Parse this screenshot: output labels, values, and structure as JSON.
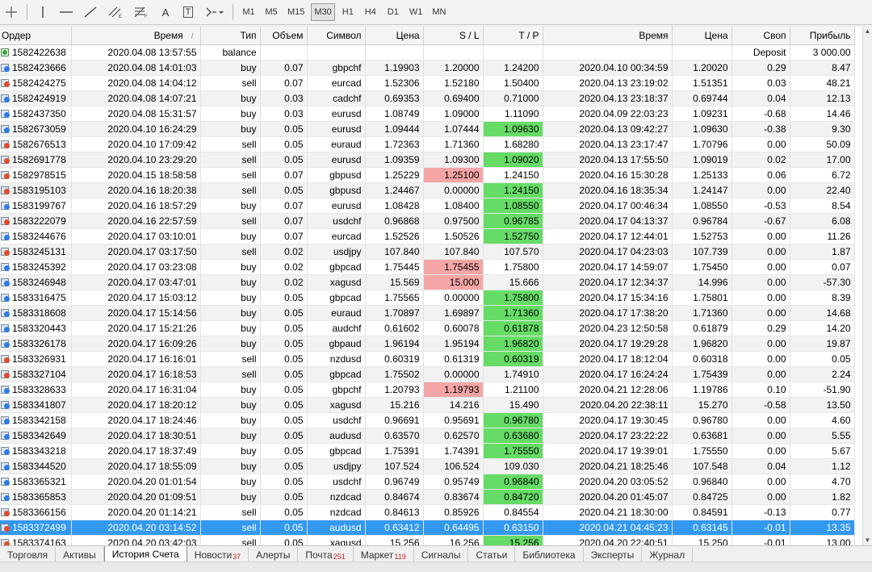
{
  "toolbar": {
    "timeframes": [
      "M1",
      "M5",
      "M15",
      "M30",
      "H1",
      "H4",
      "D1",
      "W1",
      "MN"
    ],
    "active_timeframe": "M30",
    "text_tool": "A",
    "label_tool": "T"
  },
  "columns": [
    "Ордер",
    "Время",
    "Тип",
    "Объем",
    "Символ",
    "Цена",
    "S / L",
    "T / P",
    "Время",
    "Цена",
    "Своп",
    "Прибыль"
  ],
  "rows": [
    {
      "order": "1582422638",
      "open_time": "2020.04.08 13:57:55",
      "type": "balance",
      "volume": "",
      "symbol": "",
      "open_price": "",
      "sl": "",
      "tp": "",
      "close_time": "",
      "close_price": "",
      "swap": "Deposit",
      "profit": "3 000.00"
    },
    {
      "order": "1582423666",
      "open_time": "2020.04.08 14:01:03",
      "type": "buy",
      "volume": "0.07",
      "symbol": "gbpchf",
      "open_price": "1.19903",
      "sl": "1.20000",
      "tp": "1.24200",
      "close_time": "2020.04.10 00:34:59",
      "close_price": "1.20020",
      "swap": "0.29",
      "profit": "8.47"
    },
    {
      "order": "1582424275",
      "open_time": "2020.04.08 14:04:12",
      "type": "sell",
      "volume": "0.07",
      "symbol": "eurcad",
      "open_price": "1.52306",
      "sl": "1.52180",
      "tp": "1.50400",
      "close_time": "2020.04.13 23:19:02",
      "close_price": "1.51351",
      "swap": "0.03",
      "profit": "48.21"
    },
    {
      "order": "1582424919",
      "open_time": "2020.04.08 14:07:21",
      "type": "buy",
      "volume": "0.03",
      "symbol": "cadchf",
      "open_price": "0.69353",
      "sl": "0.69400",
      "tp": "0.71000",
      "close_time": "2020.04.13 23:18:37",
      "close_price": "0.69744",
      "swap": "0.04",
      "profit": "12.13"
    },
    {
      "order": "1582437350",
      "open_time": "2020.04.08 15:31:57",
      "type": "buy",
      "volume": "0.03",
      "symbol": "eurusd",
      "open_price": "1.08749",
      "sl": "1.09000",
      "tp": "1.11090",
      "close_time": "2020.04.09 22:03:23",
      "close_price": "1.09231",
      "swap": "-0.68",
      "profit": "14.46"
    },
    {
      "order": "1582673059",
      "open_time": "2020.04.10 16:24:29",
      "type": "buy",
      "volume": "0.05",
      "symbol": "eurusd",
      "open_price": "1.09444",
      "sl": "1.07444",
      "tp": "1.09630",
      "close_time": "2020.04.13 09:42:27",
      "close_price": "1.09630",
      "swap": "-0.38",
      "profit": "9.30",
      "hl": "tp"
    },
    {
      "order": "1582676513",
      "open_time": "2020.04.10 17:09:42",
      "type": "sell",
      "volume": "0.05",
      "symbol": "euraud",
      "open_price": "1.72363",
      "sl": "1.71360",
      "tp": "1.68280",
      "close_time": "2020.04.13 23:17:47",
      "close_price": "1.70796",
      "swap": "0.00",
      "profit": "50.09"
    },
    {
      "order": "1582691778",
      "open_time": "2020.04.10 23:29:20",
      "type": "sell",
      "volume": "0.05",
      "symbol": "eurusd",
      "open_price": "1.09359",
      "sl": "1.09300",
      "tp": "1.09020",
      "close_time": "2020.04.13 17:55:50",
      "close_price": "1.09019",
      "swap": "0.02",
      "profit": "17.00",
      "hl": "tp"
    },
    {
      "order": "1582978515",
      "open_time": "2020.04.15 18:58:58",
      "type": "sell",
      "volume": "0.07",
      "symbol": "gbpusd",
      "open_price": "1.25229",
      "sl": "1.25100",
      "tp": "1.24150",
      "close_time": "2020.04.16 15:30:28",
      "close_price": "1.25133",
      "swap": "0.06",
      "profit": "6.72",
      "hl": "sl"
    },
    {
      "order": "1583195103",
      "open_time": "2020.04.16 18:20:38",
      "type": "sell",
      "volume": "0.05",
      "symbol": "gbpusd",
      "open_price": "1.24467",
      "sl": "0.00000",
      "tp": "1.24150",
      "close_time": "2020.04.16 18:35:34",
      "close_price": "1.24147",
      "swap": "0.00",
      "profit": "22.40",
      "hl": "tp"
    },
    {
      "order": "1583199767",
      "open_time": "2020.04.16 18:57:29",
      "type": "buy",
      "volume": "0.07",
      "symbol": "eurusd",
      "open_price": "1.08428",
      "sl": "1.08400",
      "tp": "1.08550",
      "close_time": "2020.04.17 00:46:34",
      "close_price": "1.08550",
      "swap": "-0.53",
      "profit": "8.54",
      "hl": "tp"
    },
    {
      "order": "1583222079",
      "open_time": "2020.04.16 22:57:59",
      "type": "sell",
      "volume": "0.07",
      "symbol": "usdchf",
      "open_price": "0.96868",
      "sl": "0.97500",
      "tp": "0.96785",
      "close_time": "2020.04.17 04:13:37",
      "close_price": "0.96784",
      "swap": "-0.67",
      "profit": "6.08",
      "hl": "tp"
    },
    {
      "order": "1583244676",
      "open_time": "2020.04.17 03:10:01",
      "type": "buy",
      "volume": "0.07",
      "symbol": "eurcad",
      "open_price": "1.52526",
      "sl": "1.50526",
      "tp": "1.52750",
      "close_time": "2020.04.17 12:44:01",
      "close_price": "1.52753",
      "swap": "0.00",
      "profit": "11.26",
      "hl": "tp"
    },
    {
      "order": "1583245131",
      "open_time": "2020.04.17 03:17:50",
      "type": "sell",
      "volume": "0.02",
      "symbol": "usdjpy",
      "open_price": "107.840",
      "sl": "107.840",
      "tp": "107.570",
      "close_time": "2020.04.17 04:23:03",
      "close_price": "107.739",
      "swap": "0.00",
      "profit": "1.87"
    },
    {
      "order": "1583245392",
      "open_time": "2020.04.17 03:23:08",
      "type": "buy",
      "volume": "0.02",
      "symbol": "gbpcad",
      "open_price": "1.75445",
      "sl": "1.75455",
      "tp": "1.75800",
      "close_time": "2020.04.17 14:59:07",
      "close_price": "1.75450",
      "swap": "0.00",
      "profit": "0.07",
      "hl": "sl"
    },
    {
      "order": "1583246948",
      "open_time": "2020.04.17 03:47:01",
      "type": "buy",
      "volume": "0.02",
      "symbol": "xagusd",
      "open_price": "15.569",
      "sl": "15.000",
      "tp": "15.666",
      "close_time": "2020.04.17 12:34:37",
      "close_price": "14.996",
      "swap": "0.00",
      "profit": "-57.30",
      "hl": "sl"
    },
    {
      "order": "1583316475",
      "open_time": "2020.04.17 15:03:12",
      "type": "buy",
      "volume": "0.05",
      "symbol": "gbpcad",
      "open_price": "1.75565",
      "sl": "0.00000",
      "tp": "1.75800",
      "close_time": "2020.04.17 15:34:16",
      "close_price": "1.75801",
      "swap": "0.00",
      "profit": "8.39",
      "hl": "tp"
    },
    {
      "order": "1583318608",
      "open_time": "2020.04.17 15:14:56",
      "type": "buy",
      "volume": "0.05",
      "symbol": "euraud",
      "open_price": "1.70897",
      "sl": "1.69897",
      "tp": "1.71360",
      "close_time": "2020.04.17 17:38:20",
      "close_price": "1.71360",
      "swap": "0.00",
      "profit": "14.68",
      "hl": "tp"
    },
    {
      "order": "1583320443",
      "open_time": "2020.04.17 15:21:26",
      "type": "buy",
      "volume": "0.05",
      "symbol": "audchf",
      "open_price": "0.61602",
      "sl": "0.60078",
      "tp": "0.61878",
      "close_time": "2020.04.23 12:50:58",
      "close_price": "0.61879",
      "swap": "0.29",
      "profit": "14.20",
      "hl": "tp"
    },
    {
      "order": "1583326178",
      "open_time": "2020.04.17 16:09:26",
      "type": "buy",
      "volume": "0.05",
      "symbol": "gbpaud",
      "open_price": "1.96194",
      "sl": "1.95194",
      "tp": "1.96820",
      "close_time": "2020.04.17 19:29:28",
      "close_price": "1.96820",
      "swap": "0.00",
      "profit": "19.87",
      "hl": "tp"
    },
    {
      "order": "1583326931",
      "open_time": "2020.04.17 16:16:01",
      "type": "sell",
      "volume": "0.05",
      "symbol": "nzdusd",
      "open_price": "0.60319",
      "sl": "0.61319",
      "tp": "0.60319",
      "close_time": "2020.04.17 18:12:04",
      "close_price": "0.60318",
      "swap": "0.00",
      "profit": "0.05",
      "hl": "tp"
    },
    {
      "order": "1583327104",
      "open_time": "2020.04.17 16:18:53",
      "type": "sell",
      "volume": "0.05",
      "symbol": "gbpcad",
      "open_price": "1.75502",
      "sl": "0.00000",
      "tp": "1.74910",
      "close_time": "2020.04.17 16:24:24",
      "close_price": "1.75439",
      "swap": "0.00",
      "profit": "2.24"
    },
    {
      "order": "1583328633",
      "open_time": "2020.04.17 16:31:04",
      "type": "buy",
      "volume": "0.05",
      "symbol": "gbpchf",
      "open_price": "1.20793",
      "sl": "1.19793",
      "tp": "1.21100",
      "close_time": "2020.04.21 12:28:06",
      "close_price": "1.19786",
      "swap": "0.10",
      "profit": "-51.90",
      "hl": "sl"
    },
    {
      "order": "1583341807",
      "open_time": "2020.04.17 18:20:12",
      "type": "buy",
      "volume": "0.05",
      "symbol": "xagusd",
      "open_price": "15.216",
      "sl": "14.216",
      "tp": "15.490",
      "close_time": "2020.04.20 22:38:11",
      "close_price": "15.270",
      "swap": "-0.58",
      "profit": "13.50"
    },
    {
      "order": "1583342158",
      "open_time": "2020.04.17 18:24:46",
      "type": "buy",
      "volume": "0.05",
      "symbol": "usdchf",
      "open_price": "0.96691",
      "sl": "0.95691",
      "tp": "0.96780",
      "close_time": "2020.04.17 19:30:45",
      "close_price": "0.96780",
      "swap": "0.00",
      "profit": "4.60",
      "hl": "tp"
    },
    {
      "order": "1583342649",
      "open_time": "2020.04.17 18:30:51",
      "type": "buy",
      "volume": "0.05",
      "symbol": "audusd",
      "open_price": "0.63570",
      "sl": "0.62570",
      "tp": "0.63680",
      "close_time": "2020.04.17 23:22:22",
      "close_price": "0.63681",
      "swap": "0.00",
      "profit": "5.55",
      "hl": "tp"
    },
    {
      "order": "1583343218",
      "open_time": "2020.04.17 18:37:49",
      "type": "buy",
      "volume": "0.05",
      "symbol": "gbpcad",
      "open_price": "1.75391",
      "sl": "1.74391",
      "tp": "1.75550",
      "close_time": "2020.04.17 19:39:01",
      "close_price": "1.75550",
      "swap": "0.00",
      "profit": "5.67",
      "hl": "tp"
    },
    {
      "order": "1583344520",
      "open_time": "2020.04.17 18:55:09",
      "type": "buy",
      "volume": "0.05",
      "symbol": "usdjpy",
      "open_price": "107.524",
      "sl": "106.524",
      "tp": "109.030",
      "close_time": "2020.04.21 18:25:46",
      "close_price": "107.548",
      "swap": "0.04",
      "profit": "1.12"
    },
    {
      "order": "1583365321",
      "open_time": "2020.04.20 01:01:54",
      "type": "buy",
      "volume": "0.05",
      "symbol": "usdchf",
      "open_price": "0.96749",
      "sl": "0.95749",
      "tp": "0.96840",
      "close_time": "2020.04.20 03:05:52",
      "close_price": "0.96840",
      "swap": "0.00",
      "profit": "4.70",
      "hl": "tp"
    },
    {
      "order": "1583365853",
      "open_time": "2020.04.20 01:09:51",
      "type": "buy",
      "volume": "0.05",
      "symbol": "nzdcad",
      "open_price": "0.84674",
      "sl": "0.83674",
      "tp": "0.84720",
      "close_time": "2020.04.20 01:45:07",
      "close_price": "0.84725",
      "swap": "0.00",
      "profit": "1.82",
      "hl": "tp"
    },
    {
      "order": "1583366156",
      "open_time": "2020.04.20 01:14:21",
      "type": "sell",
      "volume": "0.05",
      "symbol": "nzdcad",
      "open_price": "0.84613",
      "sl": "0.85926",
      "tp": "0.84554",
      "close_time": "2020.04.21 18:30:00",
      "close_price": "0.84591",
      "swap": "-0.13",
      "profit": "0.77"
    },
    {
      "order": "1583372499",
      "open_time": "2020.04.20 03:14:52",
      "type": "sell",
      "volume": "0.05",
      "symbol": "audusd",
      "open_price": "0.63412",
      "sl": "0.64495",
      "tp": "0.63150",
      "close_time": "2020.04.21 04:45:23",
      "close_price": "0.63145",
      "swap": "-0.01",
      "profit": "13.35",
      "hl": "tp",
      "selected": true
    },
    {
      "order": "1583374163",
      "open_time": "2020.04.20 03:42:03",
      "type": "sell",
      "volume": "0.05",
      "symbol": "xagusd",
      "open_price": "15.256",
      "sl": "16.256",
      "tp": "15.256",
      "close_time": "2020.04.20 22:40:51",
      "close_price": "15.250",
      "swap": "-0.01",
      "profit": "13.00",
      "hl": "tp"
    }
  ],
  "tabs": [
    {
      "label": "Торговля"
    },
    {
      "label": "Активы"
    },
    {
      "label": "История Счета",
      "active": true
    },
    {
      "label": "Новости",
      "badge": "37"
    },
    {
      "label": "Алерты"
    },
    {
      "label": "Почта",
      "badge": "251"
    },
    {
      "label": "Маркет",
      "badge": "119"
    },
    {
      "label": "Сигналы"
    },
    {
      "label": "Статьи"
    },
    {
      "label": "Библиотека"
    },
    {
      "label": "Эксперты"
    },
    {
      "label": "Журнал"
    }
  ],
  "colors": {
    "tp_hit": "#66dc66",
    "sl_hit": "#f5a5a5",
    "selected": "#3399f0"
  },
  "icons": {
    "toolbar": [
      "crosshair-icon",
      "vertical-line-icon",
      "horizontal-line-icon",
      "trendline-icon",
      "channel-icon",
      "fibonacci-icon",
      "text-icon",
      "label-icon",
      "shapes-icon"
    ],
    "row": [
      "buy-order-icon",
      "sell-order-icon",
      "balance-icon"
    ]
  }
}
